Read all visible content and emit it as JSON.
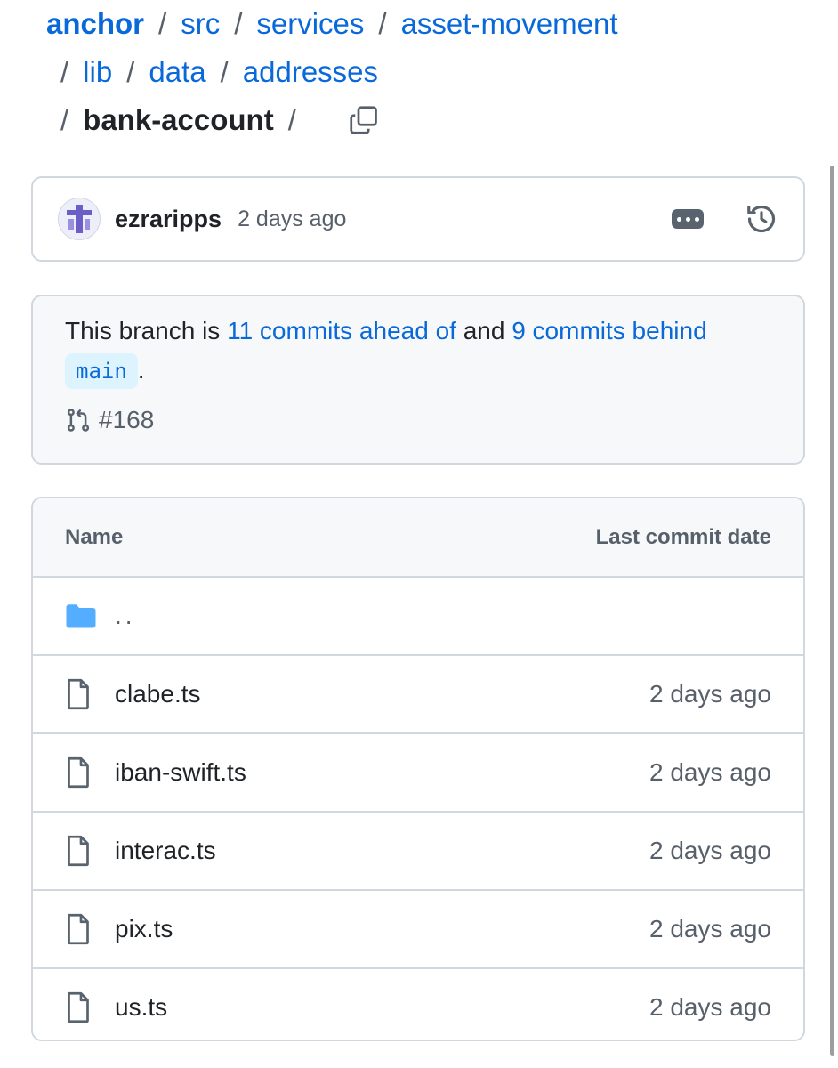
{
  "breadcrumb": {
    "root": "anchor",
    "segments": [
      "src",
      "services",
      "asset-movement",
      "lib",
      "data",
      "addresses"
    ],
    "current": "bank-account",
    "separator": "/"
  },
  "icons": {
    "copy": "copy-icon",
    "history": "history-icon",
    "more": "kebab-horizontal-icon",
    "folder": "folder-icon",
    "file": "file-icon",
    "pull_request": "git-pull-request-icon"
  },
  "commit": {
    "author": "ezraripps",
    "time": "2 days ago"
  },
  "branch": {
    "prefix": "This branch is",
    "ahead": "11 commits ahead of",
    "and": "and",
    "behind": "9 commits behind",
    "base": "main",
    "period": ".",
    "pr": "#168"
  },
  "files": {
    "headers": {
      "name": "Name",
      "date": "Last commit date"
    },
    "parent": "..",
    "rows": [
      {
        "name": "clabe.ts",
        "date": "2 days ago"
      },
      {
        "name": "iban-swift.ts",
        "date": "2 days ago"
      },
      {
        "name": "interac.ts",
        "date": "2 days ago"
      },
      {
        "name": "pix.ts",
        "date": "2 days ago"
      },
      {
        "name": "us.ts",
        "date": "2 days ago"
      }
    ]
  },
  "colors": {
    "link": "#0969da",
    "muted": "#57606a",
    "border": "#d0d7de",
    "folder": "#54aeff",
    "chip_bg": "#ddf4ff"
  }
}
